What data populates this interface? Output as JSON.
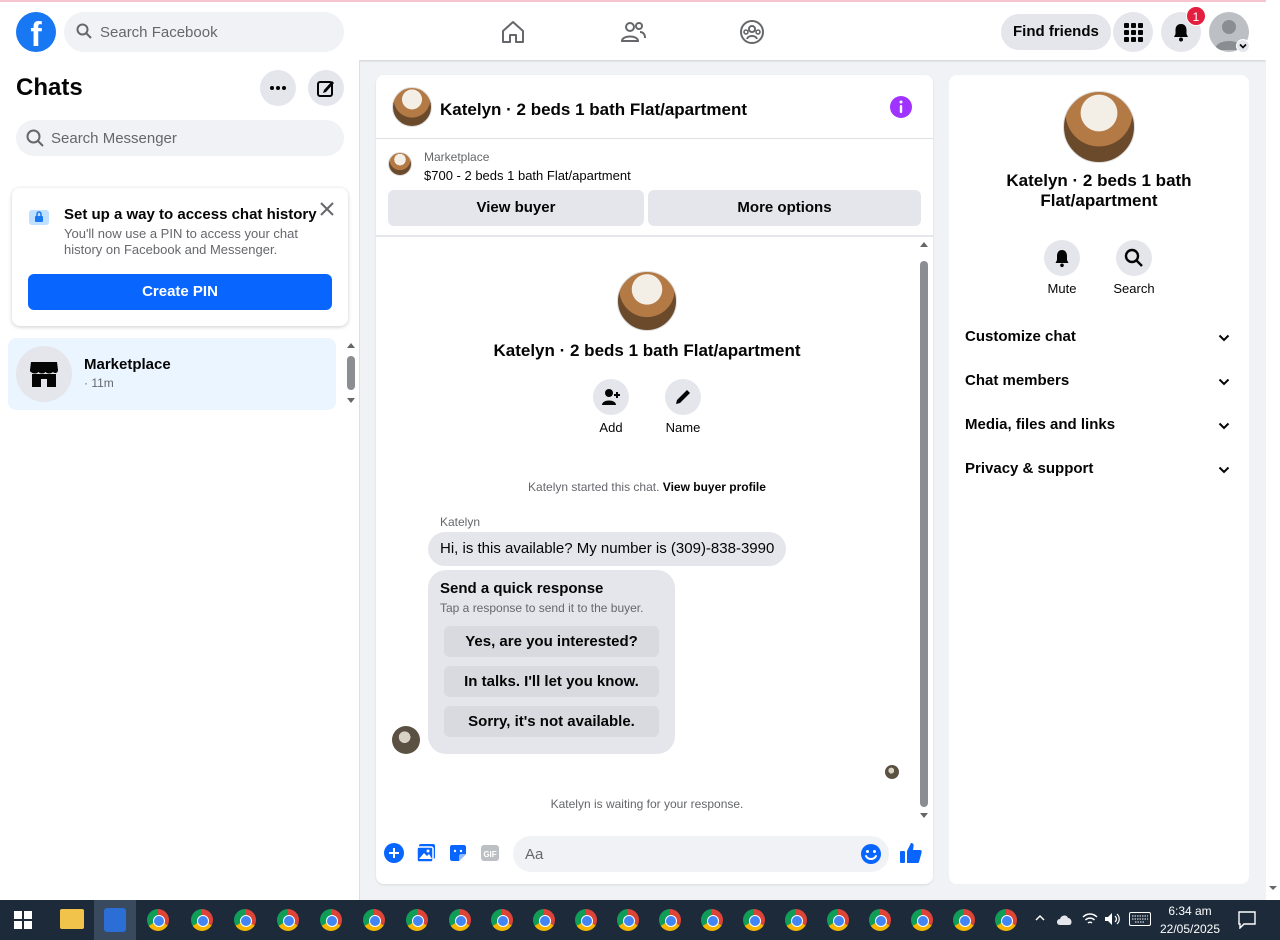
{
  "topbar": {
    "logo": "f",
    "search_placeholder": "Search Facebook",
    "find_friends": "Find friends",
    "notification_count": "1"
  },
  "sidebar": {
    "title": "Chats",
    "search_placeholder": "Search Messenger",
    "pin_card": {
      "title": "Set up a way to access chat history",
      "description": "You'll now use a PIN to access your chat history on Facebook and Messenger.",
      "button": "Create PIN"
    },
    "conversations": [
      {
        "name": "Marketplace",
        "time": "· 11m"
      }
    ]
  },
  "chat": {
    "header_title": "Katelyn · 2 beds 1 bath Flat/apartment",
    "marketplace": {
      "label": "Marketplace",
      "listing": "$700 - 2 beds 1 bath Flat/apartment",
      "view_buyer": "View buyer",
      "more_options": "More options"
    },
    "intro_title": "Katelyn · 2 beds 1 bath Flat/apartment",
    "actions": {
      "add": "Add",
      "name": "Name"
    },
    "started_text": "Katelyn started this chat.",
    "view_buyer_profile": "View buyer profile",
    "sender_name": "Katelyn",
    "message": "Hi, is this available? My number is (309)-838-3990",
    "quick_response": {
      "title": "Send a quick response",
      "subtitle": "Tap a response to send it to the buyer.",
      "options": [
        "Yes, are you interested?",
        "In talks. I'll let you know.",
        "Sorry, it's not available."
      ]
    },
    "waiting_text": "Katelyn is waiting for your response.",
    "composer_placeholder": "Aa"
  },
  "info_panel": {
    "title": "Katelyn · 2 beds 1 bath Flat/apartment",
    "mute": "Mute",
    "search": "Search",
    "sections": [
      "Customize chat",
      "Chat members",
      "Media, files and links",
      "Privacy & support"
    ]
  },
  "taskbar": {
    "time": "6:34 am",
    "date": "22/05/2025"
  },
  "colors": {
    "brand": "#1877f2",
    "primary_button": "#0866ff",
    "info_accent": "#a033ff",
    "badge": "#e41e3f"
  }
}
